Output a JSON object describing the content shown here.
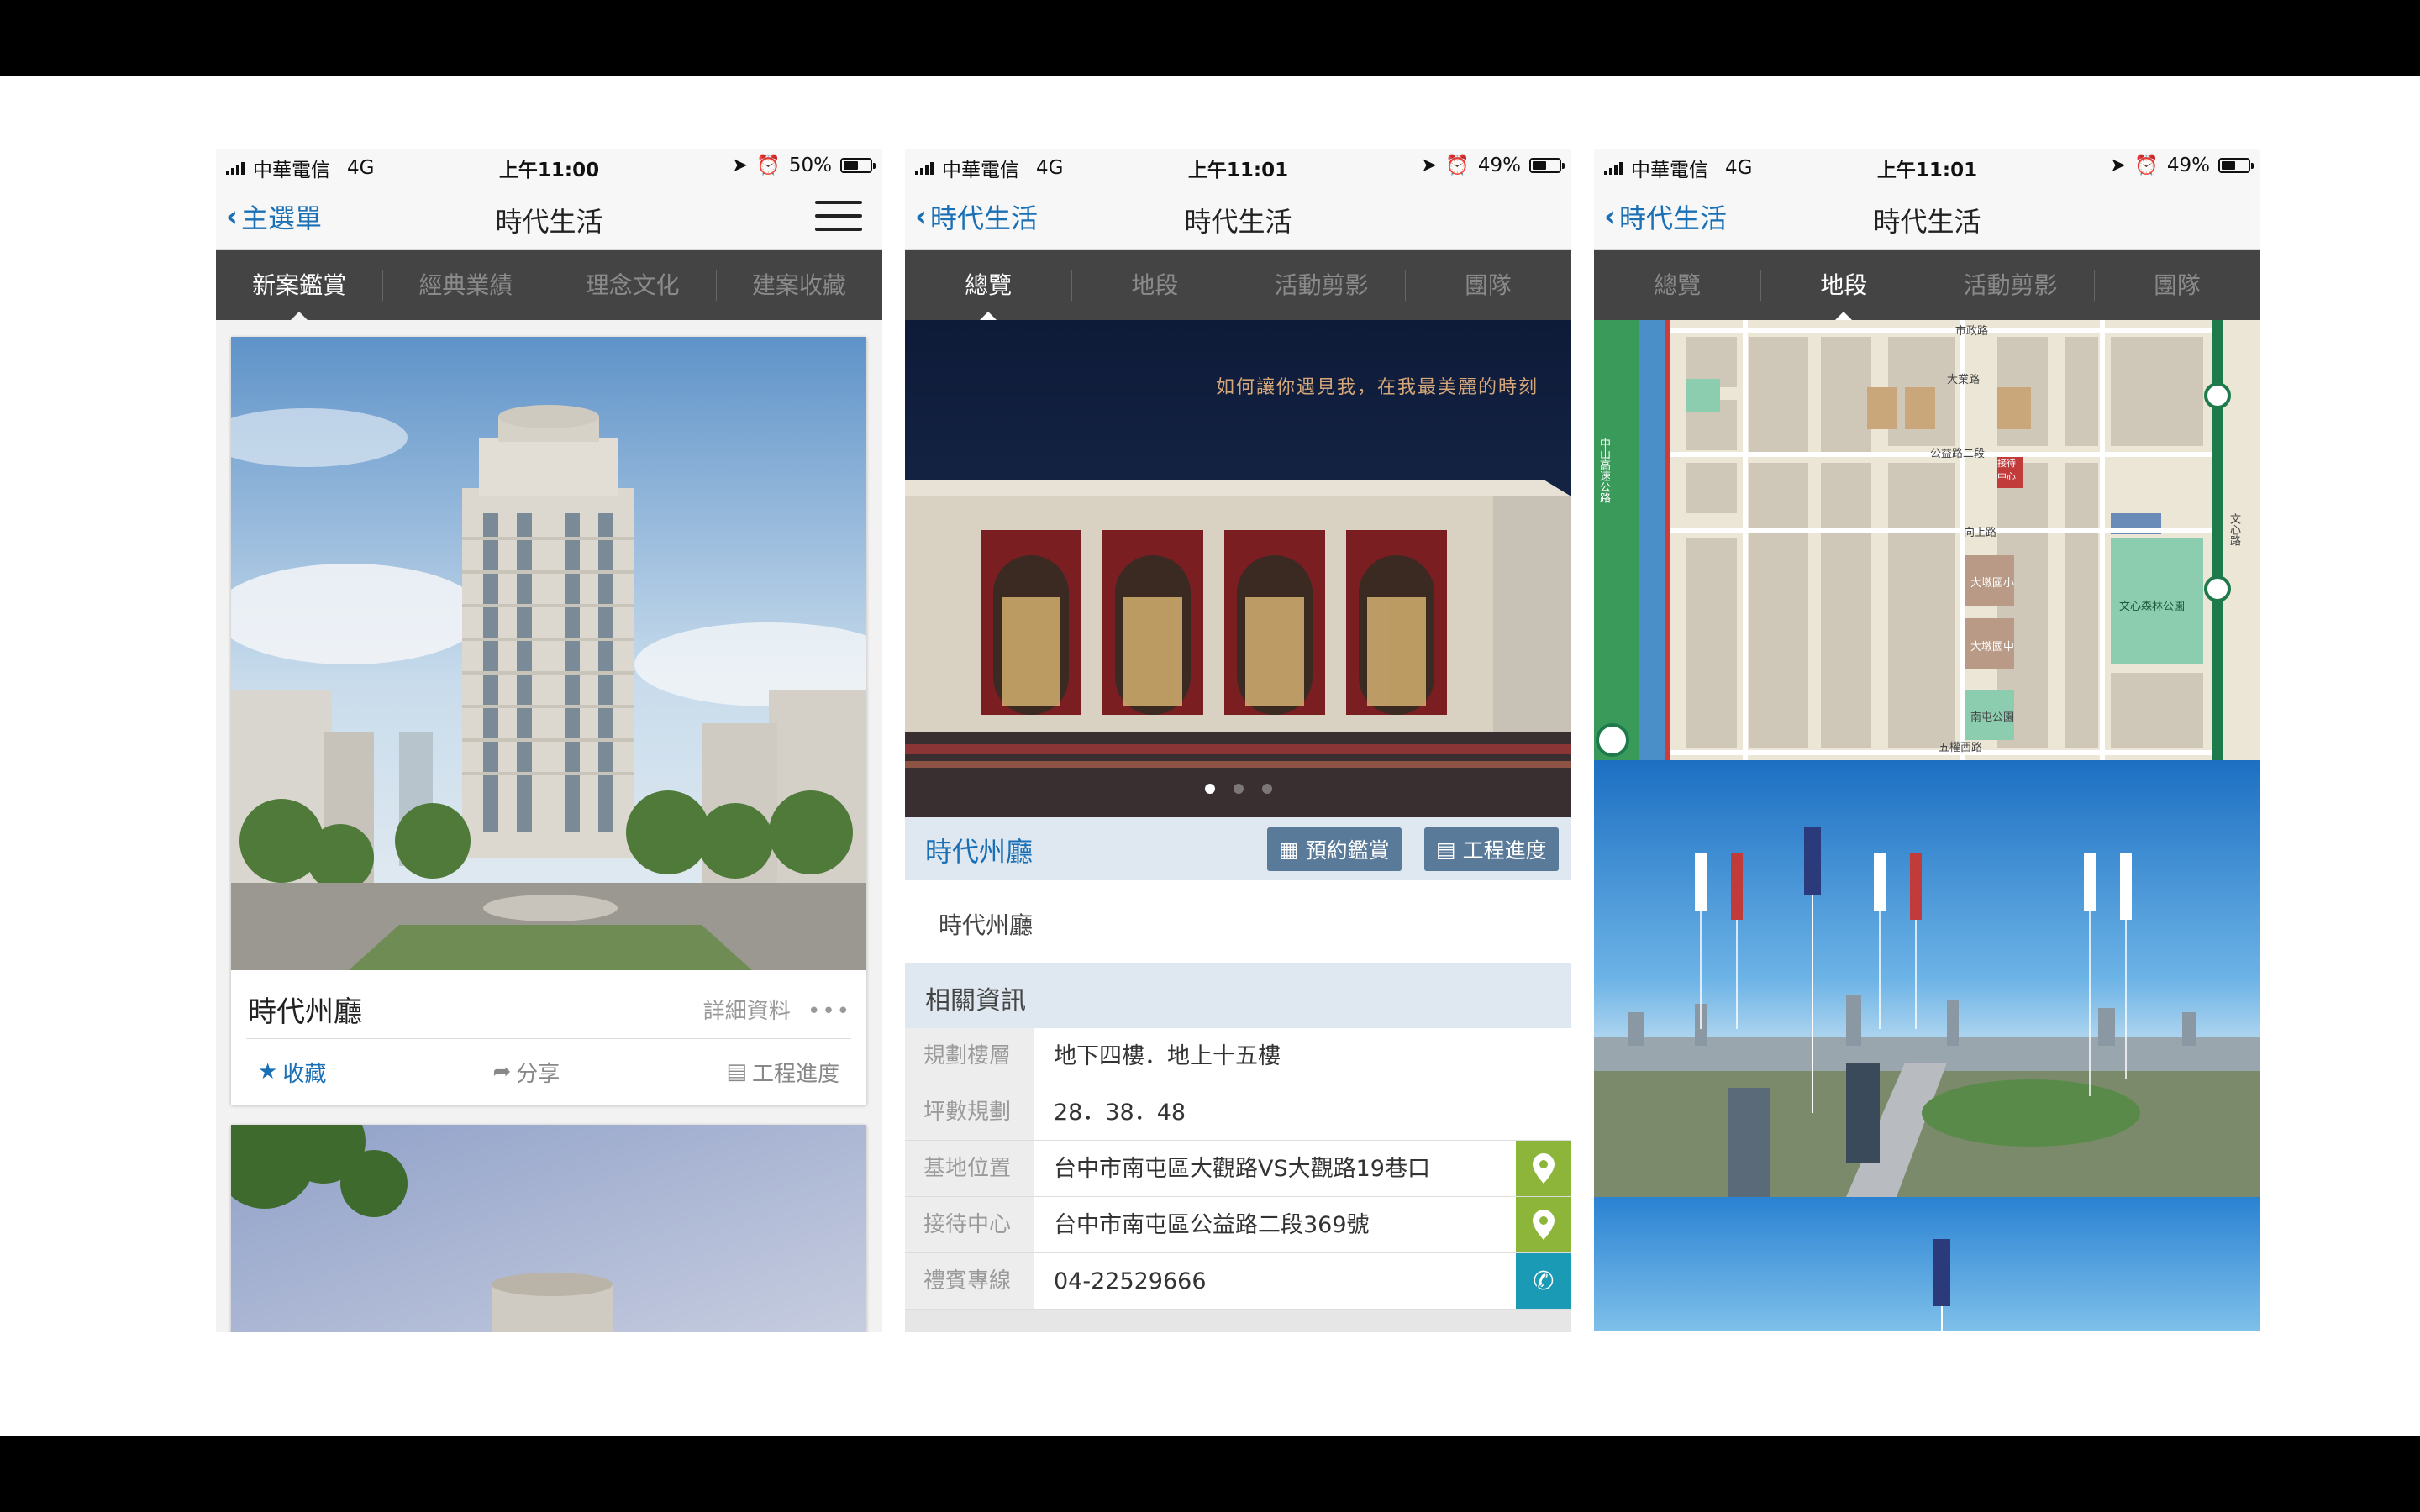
{
  "status": {
    "carrier": "中華電信",
    "network": "4G",
    "phones": [
      {
        "time": "上午11:00",
        "battery": "50%",
        "battery_level": 0.5
      },
      {
        "time": "上午11:01",
        "battery": "49%",
        "battery_level": 0.49
      },
      {
        "time": "上午11:01",
        "battery": "49%",
        "battery_level": 0.49
      }
    ]
  },
  "screen1": {
    "back_label": "主選單",
    "title": "時代生活",
    "tabs": [
      "新案鑑賞",
      "經典業績",
      "理念文化",
      "建案收藏"
    ],
    "card": {
      "title": "時代州廳",
      "more": "詳細資料",
      "favorite": "收藏",
      "share": "分享",
      "progress": "工程進度"
    }
  },
  "screen2": {
    "back_label": "時代生活",
    "title": "時代生活",
    "tabs": [
      "總覽",
      "地段",
      "活動剪影",
      "團隊"
    ],
    "banner_caption": "如何讓你遇見我，在我最美麗的時刻",
    "project_name": "時代州廳",
    "btn_reserve": "預約鑑賞",
    "btn_progress": "工程進度",
    "sub_name": "時代州廳",
    "section_title": "相關資訊",
    "rows": [
      {
        "key": "規劃樓層",
        "value": "地下四樓．地上十五樓"
      },
      {
        "key": "坪數規劃",
        "value": "28．38．48"
      },
      {
        "key": "基地位置",
        "value": "台中市南屯區大觀路VS大觀路19巷口"
      },
      {
        "key": "接待中心",
        "value": "台中市南屯區公益路二段369號"
      },
      {
        "key": "禮賓專線",
        "value": "04-22529666"
      }
    ]
  },
  "screen3": {
    "back_label": "時代生活",
    "title": "時代生活",
    "tabs": [
      "總覽",
      "地段",
      "活動剪影",
      "團隊"
    ],
    "map_labels": {
      "road1": "市政路",
      "road2": "大業路",
      "road3": "公益路二段",
      "road4": "向上路",
      "road5": "五權西路",
      "park": "文心森林公園",
      "school1": "大墩國小",
      "school2": "大墩國中",
      "park2": "南屯公園",
      "highway": "中山高速公路",
      "road6": "文心路",
      "receiving": "接待中心"
    }
  },
  "colors": {
    "accent": "#1a6fb5",
    "tab_bg": "#444444",
    "info_bg": "#dfe8f1",
    "map_pin": "#8cb53a",
    "phone_btn": "#1a9ab5"
  }
}
